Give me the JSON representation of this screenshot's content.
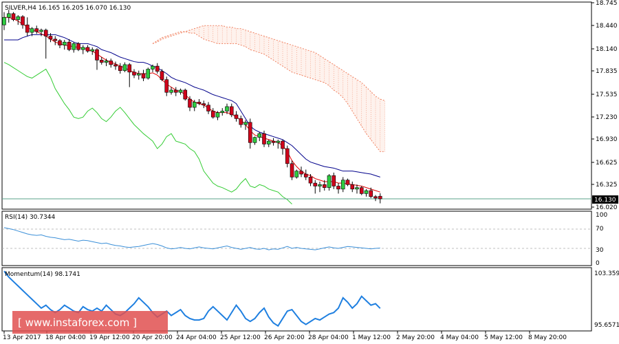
{
  "main": {
    "title": "SILVER,H4  16.165 16.205 16.070 16.130",
    "y_ticks": [
      "18.745",
      "18.440",
      "18.140",
      "17.835",
      "17.535",
      "17.230",
      "16.930",
      "16.625",
      "16.325",
      "16.020"
    ],
    "last_price": "16.130"
  },
  "rsi": {
    "title": "RSI(14) 30.7344",
    "y_ticks": [
      "100",
      "70",
      "30",
      "0"
    ]
  },
  "momentum": {
    "title": "Momentum(14) 98.1741",
    "y_ticks": [
      "103.3591",
      "95.6571"
    ]
  },
  "x_ticks": [
    "13 Apr 2017",
    "18 Apr 04:00",
    "19 Apr 12:00",
    "20 Apr 20:00",
    "24 Apr 04:00",
    "25 Apr 12:00",
    "26 Apr 20:00",
    "28 Apr 04:00",
    "1 May 12:00",
    "2 May 20:00",
    "4 May 04:00",
    "5 May 12:00",
    "8 May 20:00"
  ],
  "watermark": "[ www.instaforex.com ]",
  "colors": {
    "bull": "#2ecc40",
    "bear": "#d0021b",
    "tenkan": "#e00000",
    "kijun": "#00008b",
    "chikou": "#33cc33",
    "cloud": "#f08060",
    "rsi": "#3a8fd8",
    "momentum": "#1e7fe0",
    "watermark_bg": "#e05050"
  },
  "chart_data": [
    {
      "type": "candlestick",
      "symbol": "SILVER",
      "timeframe": "H4",
      "ylim": [
        16.02,
        18.745
      ],
      "ohlc": [
        [
          18.45,
          18.62,
          18.38,
          18.55
        ],
        [
          18.55,
          18.65,
          18.48,
          18.6
        ],
        [
          18.6,
          18.62,
          18.5,
          18.52
        ],
        [
          18.52,
          18.58,
          18.45,
          18.56
        ],
        [
          18.56,
          18.58,
          18.4,
          18.45
        ],
        [
          18.45,
          18.55,
          18.3,
          18.35
        ],
        [
          18.35,
          18.42,
          18.3,
          18.4
        ],
        [
          18.4,
          18.44,
          18.33,
          18.36
        ],
        [
          18.36,
          18.4,
          18.3,
          18.38
        ],
        [
          18.38,
          18.4,
          18.0,
          18.3
        ],
        [
          18.3,
          18.34,
          18.22,
          18.26
        ],
        [
          18.26,
          18.3,
          18.18,
          18.24
        ],
        [
          18.24,
          18.26,
          18.14,
          18.18
        ],
        [
          18.18,
          18.25,
          18.12,
          18.22
        ],
        [
          18.22,
          18.26,
          18.1,
          18.12
        ],
        [
          18.12,
          18.22,
          18.08,
          18.2
        ],
        [
          18.2,
          18.22,
          18.1,
          18.12
        ],
        [
          18.12,
          18.18,
          18.06,
          18.15
        ],
        [
          18.15,
          18.18,
          18.08,
          18.1
        ],
        [
          18.1,
          18.15,
          18.05,
          18.12
        ],
        [
          18.12,
          18.14,
          17.85,
          17.98
        ],
        [
          17.98,
          18.02,
          17.92,
          17.95
        ],
        [
          17.95,
          18.0,
          17.9,
          17.97
        ],
        [
          17.97,
          18.0,
          17.88,
          17.92
        ],
        [
          17.92,
          17.96,
          17.85,
          17.9
        ],
        [
          17.9,
          17.94,
          17.8,
          17.84
        ],
        [
          17.84,
          17.95,
          17.82,
          17.92
        ],
        [
          17.92,
          17.94,
          17.62,
          17.82
        ],
        [
          17.82,
          17.86,
          17.74,
          17.78
        ],
        [
          17.78,
          17.84,
          17.72,
          17.8
        ],
        [
          17.8,
          17.85,
          17.7,
          17.74
        ],
        [
          17.74,
          17.88,
          17.72,
          17.86
        ],
        [
          17.86,
          17.92,
          17.82,
          17.9
        ],
        [
          17.9,
          17.94,
          17.8,
          17.83
        ],
        [
          17.83,
          17.86,
          17.7,
          17.72
        ],
        [
          17.72,
          17.76,
          17.5,
          17.55
        ],
        [
          17.55,
          17.62,
          17.52,
          17.58
        ],
        [
          17.58,
          17.62,
          17.5,
          17.55
        ],
        [
          17.55,
          17.6,
          17.52,
          17.58
        ],
        [
          17.58,
          17.6,
          17.44,
          17.46
        ],
        [
          17.46,
          17.5,
          17.3,
          17.35
        ],
        [
          17.35,
          17.45,
          17.3,
          17.42
        ],
        [
          17.42,
          17.46,
          17.38,
          17.4
        ],
        [
          17.4,
          17.44,
          17.34,
          17.38
        ],
        [
          17.38,
          17.42,
          17.26,
          17.3
        ],
        [
          17.3,
          17.34,
          17.2,
          17.22
        ],
        [
          17.22,
          17.3,
          17.18,
          17.28
        ],
        [
          17.28,
          17.34,
          17.24,
          17.3
        ],
        [
          17.3,
          17.4,
          17.26,
          17.36
        ],
        [
          17.36,
          17.4,
          17.22,
          17.25
        ],
        [
          17.25,
          17.3,
          17.16,
          17.2
        ],
        [
          17.2,
          17.24,
          17.08,
          17.12
        ],
        [
          17.12,
          17.18,
          17.05,
          17.15
        ],
        [
          17.15,
          17.2,
          16.8,
          16.88
        ],
        [
          16.88,
          16.96,
          16.85,
          16.95
        ],
        [
          16.95,
          17.02,
          16.9,
          17.0
        ],
        [
          17.0,
          17.04,
          16.82,
          16.86
        ],
        [
          16.86,
          16.92,
          16.82,
          16.9
        ],
        [
          16.9,
          16.94,
          16.84,
          16.88
        ],
        [
          16.88,
          16.92,
          16.8,
          16.9
        ],
        [
          16.9,
          16.92,
          16.72,
          16.8
        ],
        [
          16.8,
          16.84,
          16.55,
          16.6
        ],
        [
          16.6,
          16.64,
          16.38,
          16.42
        ],
        [
          16.42,
          16.52,
          16.4,
          16.5
        ],
        [
          16.5,
          16.56,
          16.42,
          16.46
        ],
        [
          16.46,
          16.52,
          16.38,
          16.42
        ],
        [
          16.42,
          16.46,
          16.3,
          16.34
        ],
        [
          16.34,
          16.38,
          16.2,
          16.3
        ],
        [
          16.3,
          16.36,
          16.22,
          16.32
        ],
        [
          16.32,
          16.38,
          16.24,
          16.28
        ],
        [
          16.28,
          16.46,
          16.24,
          16.44
        ],
        [
          16.44,
          16.48,
          16.26,
          16.3
        ],
        [
          16.3,
          16.34,
          16.2,
          16.26
        ],
        [
          16.26,
          16.42,
          16.22,
          16.38
        ],
        [
          16.38,
          16.4,
          16.3,
          16.32
        ],
        [
          16.32,
          16.36,
          16.22,
          16.26
        ],
        [
          16.26,
          16.32,
          16.2,
          16.28
        ],
        [
          16.28,
          16.3,
          16.18,
          16.2
        ],
        [
          16.2,
          16.26,
          16.16,
          16.24
        ],
        [
          16.24,
          16.28,
          16.14,
          16.16
        ],
        [
          16.16,
          16.18,
          16.1,
          16.14
        ],
        [
          16.165,
          16.205,
          16.07,
          16.13
        ]
      ],
      "tenkan": [
        18.55,
        18.55,
        18.53,
        18.5,
        18.46,
        18.42,
        18.38,
        18.36,
        18.33,
        18.3,
        18.26,
        18.22,
        18.2,
        18.18,
        18.17,
        18.16,
        18.15,
        18.14,
        18.12,
        18.1,
        18.06,
        18.02,
        17.98,
        17.95,
        17.93,
        17.9,
        17.88,
        17.84,
        17.82,
        17.8,
        17.8,
        17.8,
        17.81,
        17.78,
        17.72,
        17.66,
        17.62,
        17.58,
        17.56,
        17.52,
        17.46,
        17.42,
        17.4,
        17.38,
        17.34,
        17.3,
        17.28,
        17.28,
        17.28,
        17.26,
        17.22,
        17.18,
        17.12,
        17.04,
        16.98,
        16.96,
        16.94,
        16.92,
        16.9,
        16.88,
        16.84,
        16.76,
        16.64,
        16.56,
        16.5,
        16.46,
        16.44,
        16.4,
        16.38,
        16.36,
        16.36,
        16.36,
        16.34,
        16.34,
        16.33,
        16.32,
        16.31,
        16.3,
        16.28,
        16.26,
        16.24,
        16.22
      ],
      "kijun": [
        18.25,
        18.25,
        18.25,
        18.25,
        18.28,
        18.3,
        18.32,
        18.32,
        18.32,
        18.32,
        18.32,
        18.32,
        18.3,
        18.28,
        18.25,
        18.22,
        18.2,
        18.2,
        18.2,
        18.18,
        18.16,
        18.12,
        18.1,
        18.08,
        18.05,
        18.02,
        18.0,
        17.98,
        17.96,
        17.95,
        17.95,
        17.93,
        17.9,
        17.88,
        17.84,
        17.8,
        17.75,
        17.72,
        17.7,
        17.68,
        17.65,
        17.62,
        17.6,
        17.58,
        17.55,
        17.52,
        17.5,
        17.48,
        17.46,
        17.44,
        17.4,
        17.3,
        17.2,
        17.1,
        17.05,
        17.02,
        17.0,
        16.98,
        16.96,
        16.94,
        16.92,
        16.88,
        16.84,
        16.78,
        16.72,
        16.66,
        16.62,
        16.6,
        16.58,
        16.56,
        16.55,
        16.54,
        16.52,
        16.5,
        16.5,
        16.5,
        16.49,
        16.48,
        16.47,
        16.46,
        16.44,
        16.42
      ],
      "chikou": [
        17.95,
        17.92,
        17.88,
        17.84,
        17.8,
        17.76,
        17.74,
        17.78,
        17.82,
        17.86,
        17.75,
        17.6,
        17.5,
        17.4,
        17.32,
        17.22,
        17.2,
        17.22,
        17.3,
        17.34,
        17.28,
        17.2,
        17.16,
        17.22,
        17.3,
        17.35,
        17.28,
        17.2,
        17.12,
        17.06,
        17.0,
        16.95,
        16.9,
        16.8,
        16.86,
        16.96,
        17.0,
        16.9,
        16.88,
        16.86,
        16.8,
        16.76,
        16.66,
        16.5,
        16.42,
        16.34,
        16.3,
        16.28,
        16.25,
        16.22,
        16.26,
        16.34,
        16.4,
        16.3,
        16.28,
        16.32,
        16.3,
        16.26,
        16.24,
        16.22,
        16.16,
        16.12,
        16.06
      ],
      "cloud_a": [
        18.2,
        18.24,
        18.28,
        18.3,
        18.32,
        18.34,
        18.36,
        18.36,
        18.34,
        18.34,
        18.3,
        18.26,
        18.24,
        18.22,
        18.2,
        18.2,
        18.2,
        18.2,
        18.2,
        18.18,
        18.16,
        18.12,
        18.1,
        18.08,
        18.06,
        18.02,
        17.98,
        17.94,
        17.9,
        17.86,
        17.82,
        17.8,
        17.78,
        17.76,
        17.74,
        17.72,
        17.7,
        17.68,
        17.64,
        17.58,
        17.54,
        17.48,
        17.4,
        17.3,
        17.2,
        17.1,
        17.0,
        16.92,
        16.84,
        16.76,
        16.76
      ],
      "cloud_b": [
        18.2,
        18.22,
        18.26,
        18.28,
        18.3,
        18.32,
        18.34,
        18.36,
        18.38,
        18.4,
        18.42,
        18.44,
        18.44,
        18.44,
        18.44,
        18.44,
        18.42,
        18.42,
        18.4,
        18.4,
        18.38,
        18.36,
        18.34,
        18.32,
        18.3,
        18.28,
        18.26,
        18.24,
        18.22,
        18.2,
        18.18,
        18.16,
        18.14,
        18.12,
        18.1,
        18.08,
        18.04,
        18.0,
        17.96,
        17.92,
        17.88,
        17.84,
        17.8,
        17.76,
        17.72,
        17.68,
        17.62,
        17.56,
        17.5,
        17.46,
        17.44
      ]
    },
    {
      "type": "line",
      "name": "RSI(14)",
      "ylim": [
        0,
        100
      ],
      "levels": [
        70,
        30
      ],
      "values": [
        73,
        71,
        69,
        66,
        63,
        60,
        58,
        57,
        58,
        55,
        53,
        52,
        50,
        48,
        49,
        47,
        45,
        47,
        46,
        44,
        42,
        40,
        41,
        38,
        36,
        35,
        33,
        32,
        33,
        34,
        36,
        38,
        40,
        38,
        35,
        31,
        29,
        30,
        32,
        30,
        29,
        31,
        33,
        31,
        30,
        29,
        31,
        33,
        35,
        32,
        30,
        28,
        30,
        32,
        29,
        28,
        30,
        27,
        29,
        28,
        31,
        34,
        30,
        32,
        30,
        29,
        28,
        27,
        29,
        31,
        33,
        31,
        30,
        32,
        34,
        33,
        32,
        31,
        30,
        29,
        30,
        30.73
      ]
    },
    {
      "type": "line",
      "name": "Momentum(14)",
      "ylim": [
        95.4,
        103.4
      ],
      "values": [
        103.2,
        102.4,
        101.8,
        101.2,
        100.6,
        100.0,
        99.4,
        98.8,
        98.2,
        98.6,
        98.0,
        97.6,
        98.0,
        98.6,
        98.2,
        97.8,
        97.6,
        98.4,
        98.0,
        97.8,
        98.2,
        97.8,
        98.6,
        98.0,
        97.4,
        97.2,
        97.6,
        98.2,
        98.8,
        99.6,
        99.0,
        98.4,
        97.6,
        97.0,
        97.4,
        97.8,
        97.2,
        97.6,
        98.0,
        97.2,
        96.8,
        96.6,
        96.6,
        96.8,
        97.8,
        98.4,
        97.8,
        97.2,
        96.6,
        97.6,
        98.6,
        97.8,
        96.8,
        96.4,
        96.8,
        97.6,
        98.2,
        97.0,
        96.2,
        95.8,
        96.8,
        97.8,
        98.0,
        97.2,
        96.4,
        96.0,
        96.4,
        96.8,
        96.6,
        97.0,
        97.4,
        97.6,
        98.2,
        99.6,
        99.0,
        98.2,
        98.8,
        99.8,
        99.2,
        98.6,
        98.8,
        98.17
      ]
    }
  ]
}
